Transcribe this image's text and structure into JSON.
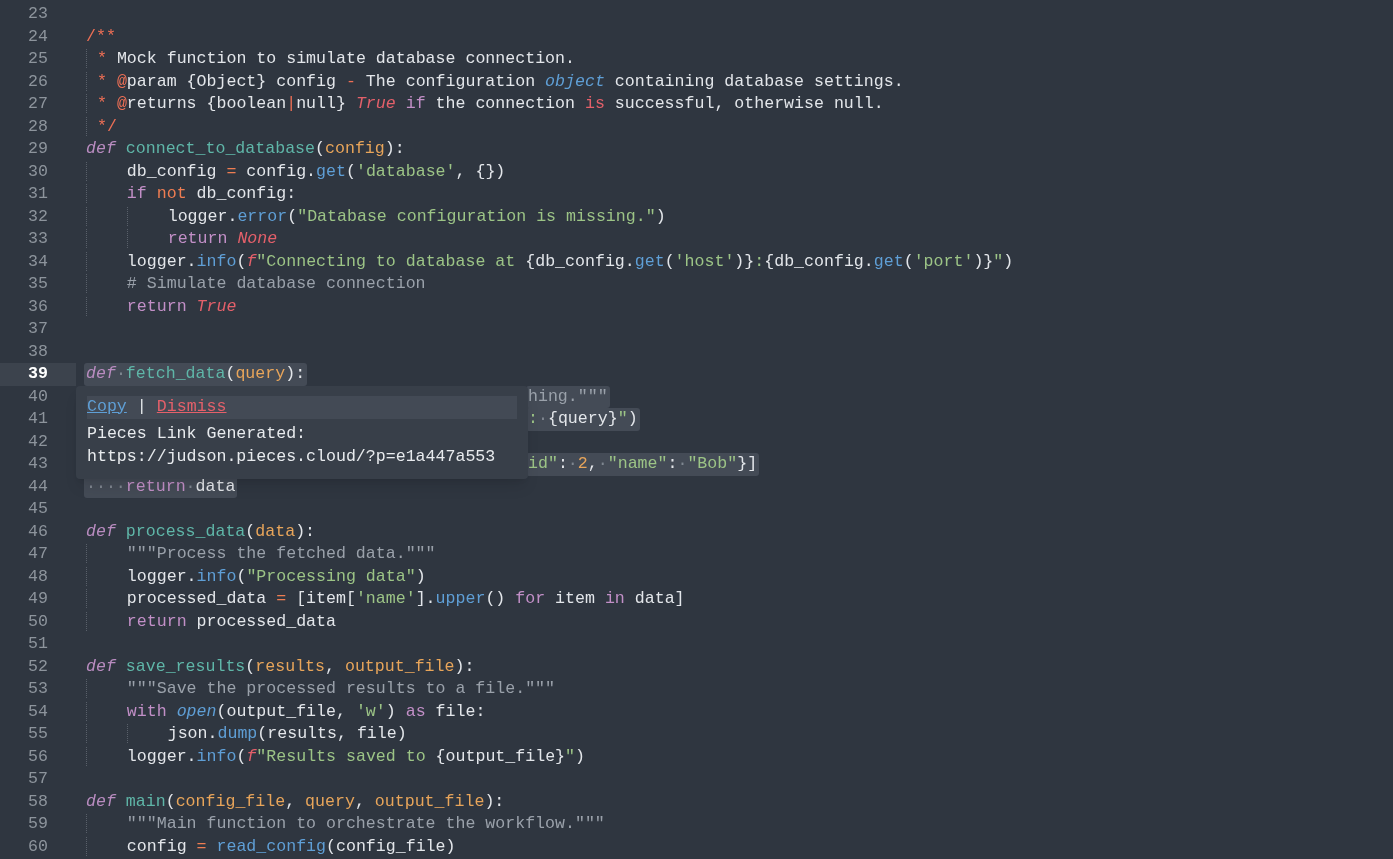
{
  "editor": {
    "lines": [
      {
        "number": "23",
        "selected": false,
        "current": false,
        "under_popup": false
      },
      {
        "number": "24",
        "selected": false,
        "current": false,
        "under_popup": false,
        "tokens": [
          {
            "kind": "cmark",
            "text": "/**"
          }
        ]
      },
      {
        "number": "25",
        "selected": false,
        "current": false,
        "under_popup": false,
        "tokens": [
          {
            "kind": "cmark",
            "text": " *"
          },
          {
            "kind": "plain",
            "text": " Mock function to simulate database connection."
          }
        ]
      },
      {
        "number": "26",
        "selected": false,
        "current": false,
        "under_popup": false,
        "tokens": [
          {
            "kind": "cmark",
            "text": " *"
          },
          {
            "kind": "cmark",
            "text": " @"
          },
          {
            "kind": "plain",
            "text": "param {Object} config "
          },
          {
            "kind": "cmark",
            "text": "-"
          },
          {
            "kind": "plain",
            "text": " The configuration "
          },
          {
            "kind": "cobj",
            "text": "object"
          },
          {
            "kind": "plain",
            "text": " containing database settings."
          }
        ]
      },
      {
        "number": "27",
        "selected": false,
        "current": false,
        "under_popup": false,
        "tokens": [
          {
            "kind": "cmark",
            "text": " *"
          },
          {
            "kind": "cmark",
            "text": " @"
          },
          {
            "kind": "plain",
            "text": "returns {boolean"
          },
          {
            "kind": "cmark",
            "text": "|"
          },
          {
            "kind": "plain",
            "text": "null} "
          },
          {
            "kind": "const",
            "text": "True"
          },
          {
            "kind": "kw",
            "text": " if"
          },
          {
            "kind": "plain",
            "text": " the connection "
          },
          {
            "kind": "cred",
            "text": "is"
          },
          {
            "kind": "plain",
            "text": " successful, otherwise null."
          }
        ]
      },
      {
        "number": "28",
        "selected": false,
        "current": false,
        "under_popup": false,
        "tokens": [
          {
            "kind": "cmark",
            "text": " */"
          }
        ]
      },
      {
        "number": "29",
        "selected": false,
        "current": false,
        "under_popup": false,
        "tokens": [
          {
            "kind": "kwi",
            "text": "def"
          },
          {
            "kind": "fn",
            "text": " connect_to_database"
          },
          {
            "kind": "plain",
            "text": "("
          },
          {
            "kind": "param",
            "text": "config"
          },
          {
            "kind": "plain",
            "text": "):"
          }
        ]
      },
      {
        "number": "30",
        "selected": false,
        "current": false,
        "under_popup": false,
        "tokens": [
          {
            "kind": "plain",
            "text": "    db_config "
          },
          {
            "kind": "op",
            "text": "="
          },
          {
            "kind": "plain",
            "text": " config."
          },
          {
            "kind": "method",
            "text": "get"
          },
          {
            "kind": "plain",
            "text": "("
          },
          {
            "kind": "str",
            "text": "'database'"
          },
          {
            "kind": "plain",
            "text": ", {})"
          }
        ]
      },
      {
        "number": "31",
        "selected": false,
        "current": false,
        "under_popup": false,
        "tokens": [
          {
            "kind": "kw",
            "text": "    if"
          },
          {
            "kind": "op",
            "text": " not"
          },
          {
            "kind": "plain",
            "text": " db_config:"
          }
        ]
      },
      {
        "number": "32",
        "selected": false,
        "current": false,
        "under_popup": false,
        "tokens": [
          {
            "kind": "plain",
            "text": "        logger."
          },
          {
            "kind": "method",
            "text": "error"
          },
          {
            "kind": "plain",
            "text": "("
          },
          {
            "kind": "str",
            "text": "\"Database configuration is missing.\""
          },
          {
            "kind": "plain",
            "text": ")"
          }
        ]
      },
      {
        "number": "33",
        "selected": false,
        "current": false,
        "under_popup": false,
        "tokens": [
          {
            "kind": "kw",
            "text": "        return"
          },
          {
            "kind": "const",
            "text": " None"
          }
        ]
      },
      {
        "number": "34",
        "selected": false,
        "current": false,
        "under_popup": false,
        "tokens": [
          {
            "kind": "plain",
            "text": "    logger."
          },
          {
            "kind": "method",
            "text": "info"
          },
          {
            "kind": "plain",
            "text": "("
          },
          {
            "kind": "const",
            "text": "f"
          },
          {
            "kind": "str",
            "text": "\"Connecting to database at "
          },
          {
            "kind": "plain",
            "text": "{db_config."
          },
          {
            "kind": "method",
            "text": "get"
          },
          {
            "kind": "plain",
            "text": "("
          },
          {
            "kind": "str",
            "text": "'host'"
          },
          {
            "kind": "plain",
            "text": ")}"
          },
          {
            "kind": "str",
            "text": ":"
          },
          {
            "kind": "plain",
            "text": "{db_config."
          },
          {
            "kind": "method",
            "text": "get"
          },
          {
            "kind": "plain",
            "text": "("
          },
          {
            "kind": "str",
            "text": "'port'"
          },
          {
            "kind": "plain",
            "text": ")}"
          },
          {
            "kind": "str",
            "text": "\""
          },
          {
            "kind": "plain",
            "text": ")"
          }
        ]
      },
      {
        "number": "35",
        "selected": false,
        "current": false,
        "under_popup": false,
        "tokens": [
          {
            "kind": "cmt",
            "text": "    # Simulate database connection"
          }
        ]
      },
      {
        "number": "36",
        "selected": false,
        "current": false,
        "under_popup": false,
        "tokens": [
          {
            "kind": "kw",
            "text": "    return"
          },
          {
            "kind": "const",
            "text": " True"
          }
        ]
      },
      {
        "number": "37",
        "selected": false,
        "current": false,
        "under_popup": false
      },
      {
        "number": "38",
        "selected": false,
        "current": false,
        "under_popup": false
      },
      {
        "number": "39",
        "selected": true,
        "current": true,
        "under_popup": false,
        "tokens": [
          {
            "kind": "kwi",
            "text": "def"
          },
          {
            "kind": "ws",
            "text": "·"
          },
          {
            "kind": "fn",
            "text": "fetch_data"
          },
          {
            "kind": "plain",
            "text": "("
          },
          {
            "kind": "param",
            "text": "query"
          },
          {
            "kind": "plain",
            "text": "):"
          }
        ]
      },
      {
        "number": "40",
        "selected": true,
        "current": false,
        "under_popup": true,
        "tokens": [
          {
            "kind": "doc",
            "text": "hing.\"\"\""
          }
        ]
      },
      {
        "number": "41",
        "selected": true,
        "current": false,
        "under_popup": true,
        "tokens": [
          {
            "kind": "str",
            "text": ":"
          },
          {
            "kind": "ws",
            "text": "·"
          },
          {
            "kind": "plain",
            "text": "{query}"
          },
          {
            "kind": "str",
            "text": "\""
          },
          {
            "kind": "plain",
            "text": ")"
          }
        ]
      },
      {
        "number": "42",
        "current": false,
        "under_popup": true
      },
      {
        "number": "43",
        "selected": true,
        "current": false,
        "under_popup": true,
        "tokens": [
          {
            "kind": "str",
            "text": "id\""
          },
          {
            "kind": "plain",
            "text": ":"
          },
          {
            "kind": "ws",
            "text": "·"
          },
          {
            "kind": "num",
            "text": "2"
          },
          {
            "kind": "plain",
            "text": ","
          },
          {
            "kind": "ws",
            "text": "·"
          },
          {
            "kind": "str",
            "text": "\"name\""
          },
          {
            "kind": "plain",
            "text": ":"
          },
          {
            "kind": "ws",
            "text": "·"
          },
          {
            "kind": "str",
            "text": "\"Bob\""
          },
          {
            "kind": "plain",
            "text": "}]"
          }
        ]
      },
      {
        "number": "44",
        "selected": true,
        "current": false,
        "under_popup": false,
        "tokens": [
          {
            "kind": "ws",
            "text": "····"
          },
          {
            "kind": "kw",
            "text": "return"
          },
          {
            "kind": "ws",
            "text": "·"
          },
          {
            "kind": "plain",
            "text": "data"
          }
        ]
      },
      {
        "number": "45",
        "selected": false,
        "current": false,
        "under_popup": false
      },
      {
        "number": "46",
        "selected": false,
        "current": false,
        "under_popup": false,
        "tokens": [
          {
            "kind": "kwi",
            "text": "def"
          },
          {
            "kind": "fn",
            "text": " process_data"
          },
          {
            "kind": "plain",
            "text": "("
          },
          {
            "kind": "param",
            "text": "data"
          },
          {
            "kind": "plain",
            "text": "):"
          }
        ]
      },
      {
        "number": "47",
        "selected": false,
        "current": false,
        "under_popup": false,
        "tokens": [
          {
            "kind": "doc",
            "text": "    \"\"\"Process the fetched data.\"\"\""
          }
        ]
      },
      {
        "number": "48",
        "selected": false,
        "current": false,
        "under_popup": false,
        "tokens": [
          {
            "kind": "plain",
            "text": "    logger."
          },
          {
            "kind": "method",
            "text": "info"
          },
          {
            "kind": "plain",
            "text": "("
          },
          {
            "kind": "str",
            "text": "\"Processing data\""
          },
          {
            "kind": "plain",
            "text": ")"
          }
        ]
      },
      {
        "number": "49",
        "selected": false,
        "current": false,
        "under_popup": false,
        "tokens": [
          {
            "kind": "plain",
            "text": "    processed_data "
          },
          {
            "kind": "op",
            "text": "="
          },
          {
            "kind": "plain",
            "text": " [item["
          },
          {
            "kind": "str",
            "text": "'name'"
          },
          {
            "kind": "plain",
            "text": "]."
          },
          {
            "kind": "method",
            "text": "upper"
          },
          {
            "kind": "plain",
            "text": "() "
          },
          {
            "kind": "kw",
            "text": "for"
          },
          {
            "kind": "plain",
            "text": " item "
          },
          {
            "kind": "kw",
            "text": "in"
          },
          {
            "kind": "plain",
            "text": " data]"
          }
        ]
      },
      {
        "number": "50",
        "selected": false,
        "current": false,
        "under_popup": false,
        "tokens": [
          {
            "kind": "kw",
            "text": "    return"
          },
          {
            "kind": "plain",
            "text": " processed_data"
          }
        ]
      },
      {
        "number": "51",
        "selected": false,
        "current": false,
        "under_popup": false
      },
      {
        "number": "52",
        "selected": false,
        "current": false,
        "under_popup": false,
        "tokens": [
          {
            "kind": "kwi",
            "text": "def"
          },
          {
            "kind": "fn",
            "text": " save_results"
          },
          {
            "kind": "plain",
            "text": "("
          },
          {
            "kind": "param",
            "text": "results"
          },
          {
            "kind": "plain",
            "text": ", "
          },
          {
            "kind": "param",
            "text": "output_file"
          },
          {
            "kind": "plain",
            "text": "):"
          }
        ]
      },
      {
        "number": "53",
        "selected": false,
        "current": false,
        "under_popup": false,
        "tokens": [
          {
            "kind": "doc",
            "text": "    \"\"\"Save the processed results to a file.\"\"\""
          }
        ]
      },
      {
        "number": "54",
        "selected": false,
        "current": false,
        "under_popup": false,
        "tokens": [
          {
            "kind": "kw",
            "text": "    with"
          },
          {
            "kind": "builtin",
            "text": " open"
          },
          {
            "kind": "plain",
            "text": "(output_file, "
          },
          {
            "kind": "str",
            "text": "'w'"
          },
          {
            "kind": "plain",
            "text": ") "
          },
          {
            "kind": "kw",
            "text": "as"
          },
          {
            "kind": "plain",
            "text": " file:"
          }
        ]
      },
      {
        "number": "55",
        "selected": false,
        "current": false,
        "under_popup": false,
        "tokens": [
          {
            "kind": "plain",
            "text": "        json."
          },
          {
            "kind": "method",
            "text": "dump"
          },
          {
            "kind": "plain",
            "text": "(results, file)"
          }
        ]
      },
      {
        "number": "56",
        "selected": false,
        "current": false,
        "under_popup": false,
        "tokens": [
          {
            "kind": "plain",
            "text": "    logger."
          },
          {
            "kind": "method",
            "text": "info"
          },
          {
            "kind": "plain",
            "text": "("
          },
          {
            "kind": "const",
            "text": "f"
          },
          {
            "kind": "str",
            "text": "\"Results saved to "
          },
          {
            "kind": "plain",
            "text": "{output_file}"
          },
          {
            "kind": "str",
            "text": "\""
          },
          {
            "kind": "plain",
            "text": ")"
          }
        ]
      },
      {
        "number": "57",
        "selected": false,
        "current": false,
        "under_popup": false
      },
      {
        "number": "58",
        "selected": false,
        "current": false,
        "under_popup": false,
        "tokens": [
          {
            "kind": "kwi",
            "text": "def"
          },
          {
            "kind": "fn",
            "text": " main"
          },
          {
            "kind": "plain",
            "text": "("
          },
          {
            "kind": "param",
            "text": "config_file"
          },
          {
            "kind": "plain",
            "text": ", "
          },
          {
            "kind": "param",
            "text": "query"
          },
          {
            "kind": "plain",
            "text": ", "
          },
          {
            "kind": "param",
            "text": "output_file"
          },
          {
            "kind": "plain",
            "text": "):"
          }
        ]
      },
      {
        "number": "59",
        "selected": false,
        "current": false,
        "under_popup": false,
        "tokens": [
          {
            "kind": "doc",
            "text": "    \"\"\"Main function to orchestrate the workflow.\"\"\""
          }
        ]
      },
      {
        "number": "60",
        "selected": false,
        "current": false,
        "under_popup": false,
        "tokens": [
          {
            "kind": "plain",
            "text": "    config "
          },
          {
            "kind": "op",
            "text": "="
          },
          {
            "kind": "method",
            "text": " read_config"
          },
          {
            "kind": "plain",
            "text": "(config_file)"
          }
        ]
      }
    ]
  },
  "popup": {
    "links": [
      {
        "label": "Copy",
        "kind": "primary"
      },
      {
        "label": "Dismiss",
        "kind": "danger"
      }
    ],
    "separator": "|",
    "message": "Pieces Link Generated:",
    "url": "https://judson.pieces.cloud/?p=e1a447a553"
  }
}
